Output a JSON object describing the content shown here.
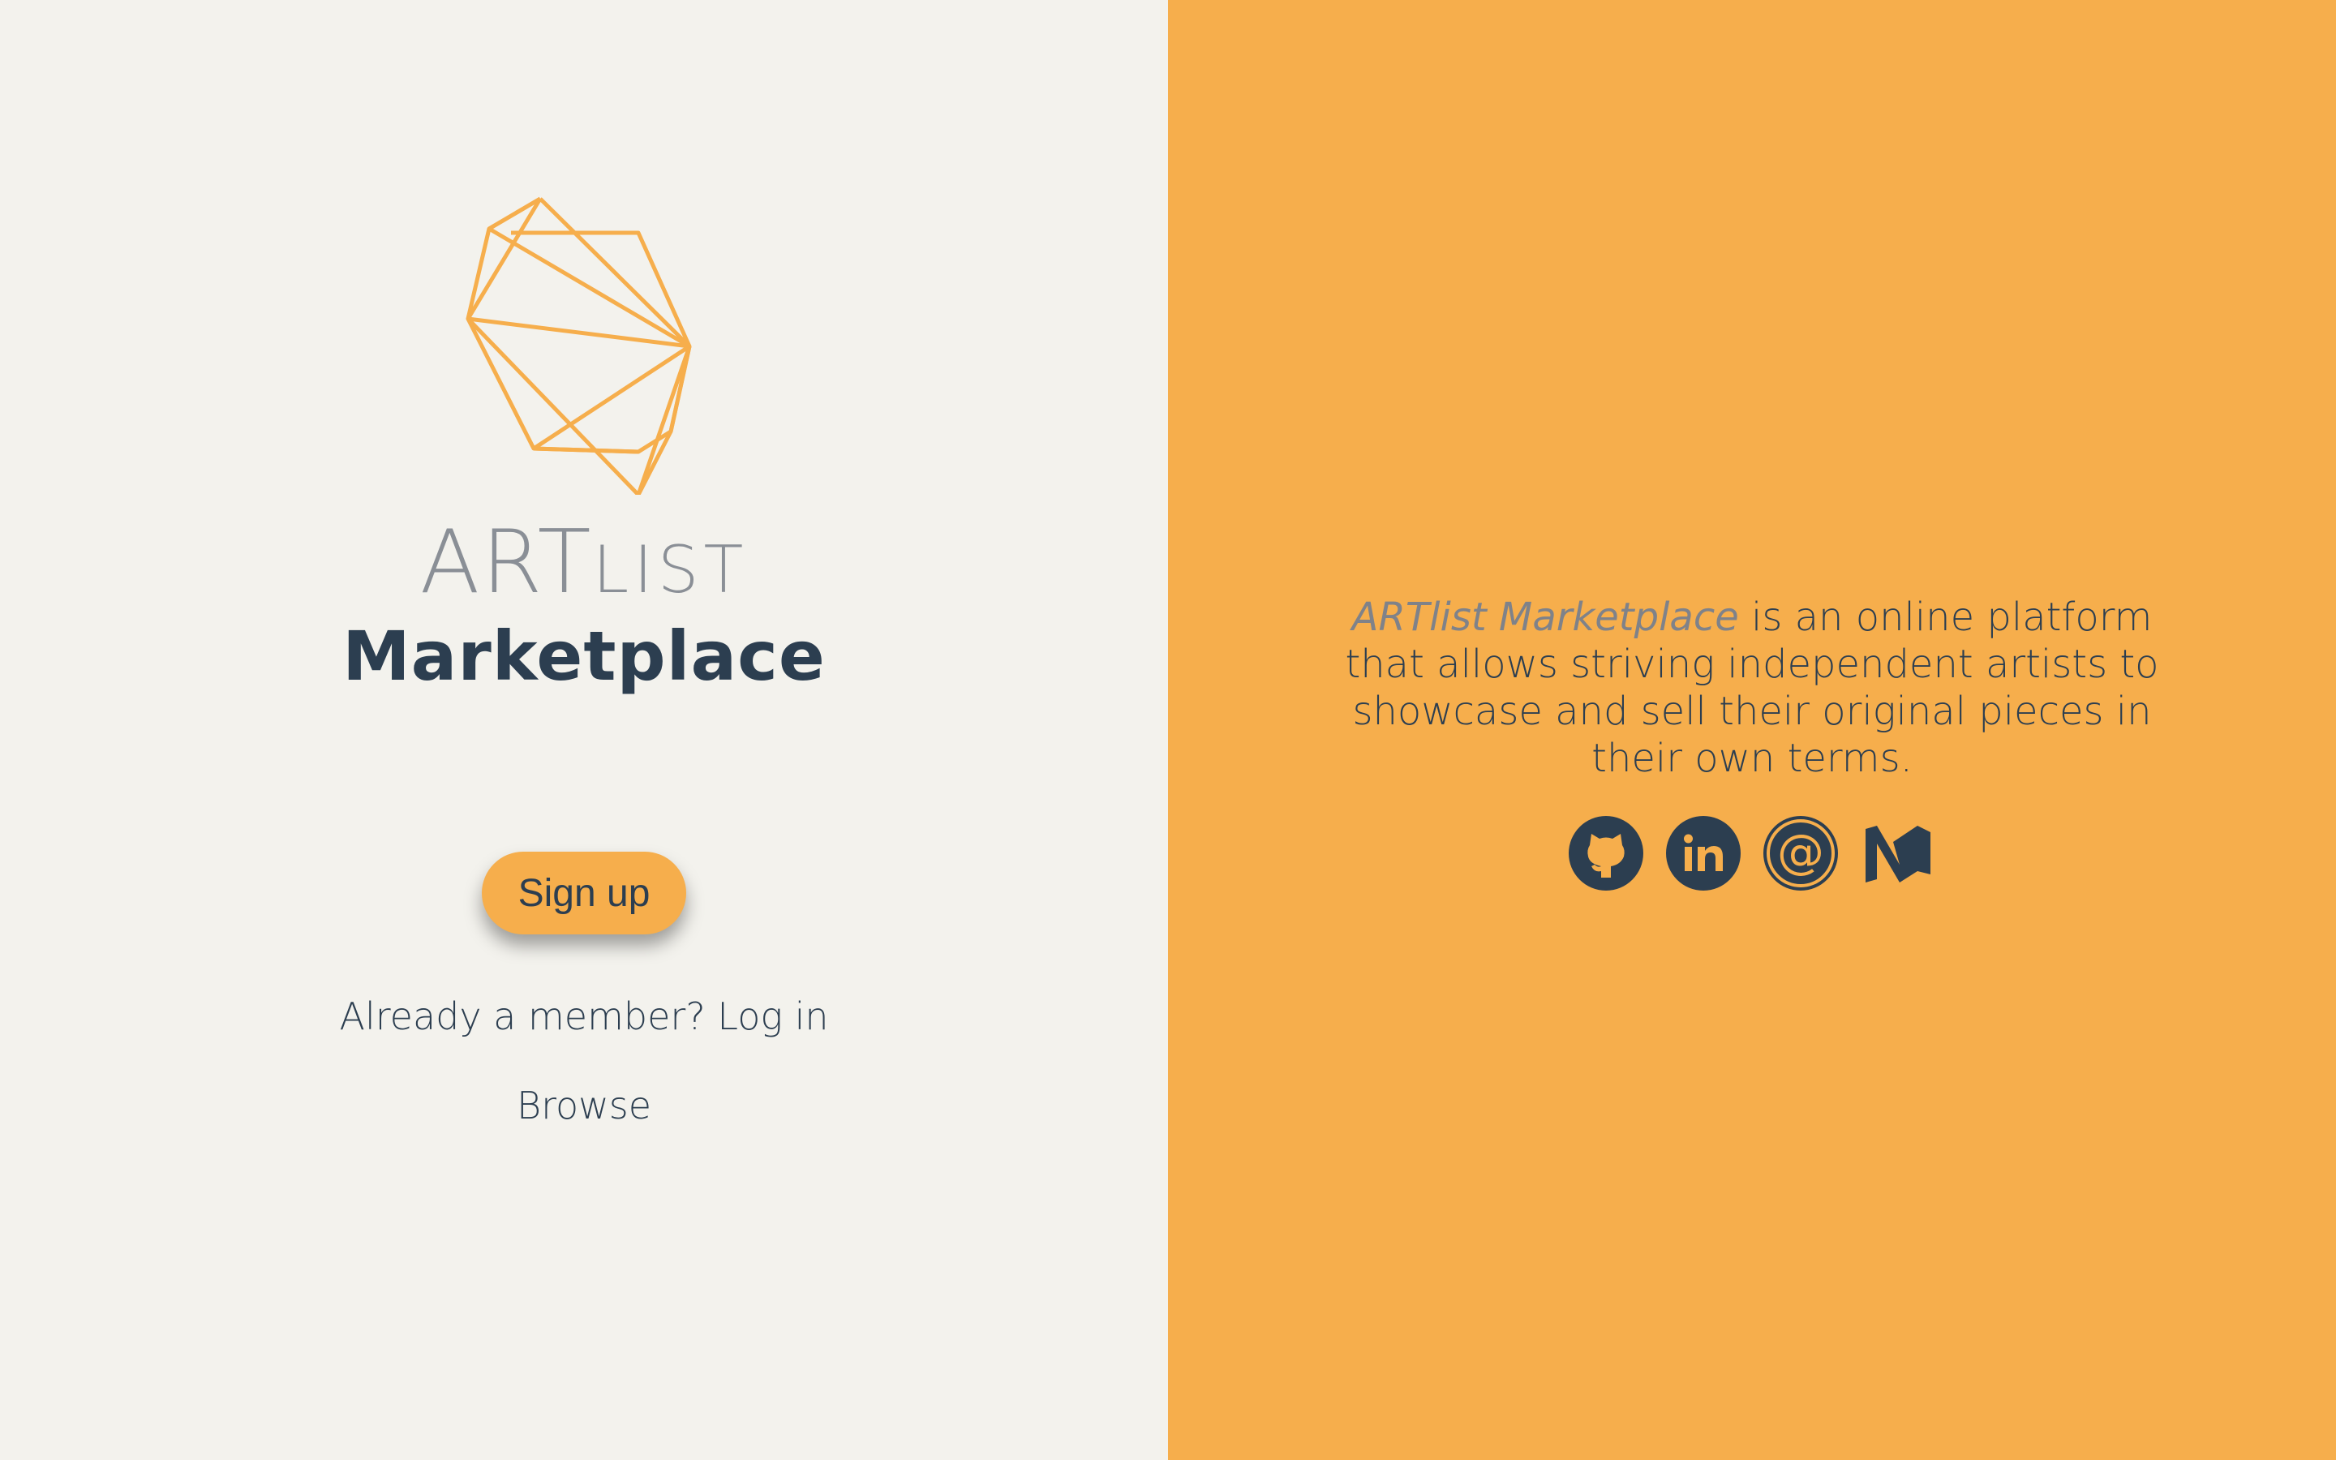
{
  "brand": {
    "name_big": "ART",
    "name_small": "LIST",
    "subtitle": "Marketplace",
    "logo_icon": "geometric-gem-logo"
  },
  "auth": {
    "signup_label": "Sign up",
    "member_prompt": "Already a member?",
    "login_label": "Log in",
    "browse_label": "Browse"
  },
  "about": {
    "brand_phrase": "ARTlist Marketplace",
    "description": " is an online platform that allows striving independent artists to showcase and sell their original pieces in their own terms."
  },
  "socials": [
    {
      "name": "github-icon"
    },
    {
      "name": "linkedin-icon"
    },
    {
      "name": "email-icon"
    },
    {
      "name": "medium-icon"
    }
  ],
  "colors": {
    "left_bg": "#f3f2ed",
    "accent": "#f6ae4c",
    "navy": "#2c3e50",
    "muted_gray": "#8a8f96"
  }
}
